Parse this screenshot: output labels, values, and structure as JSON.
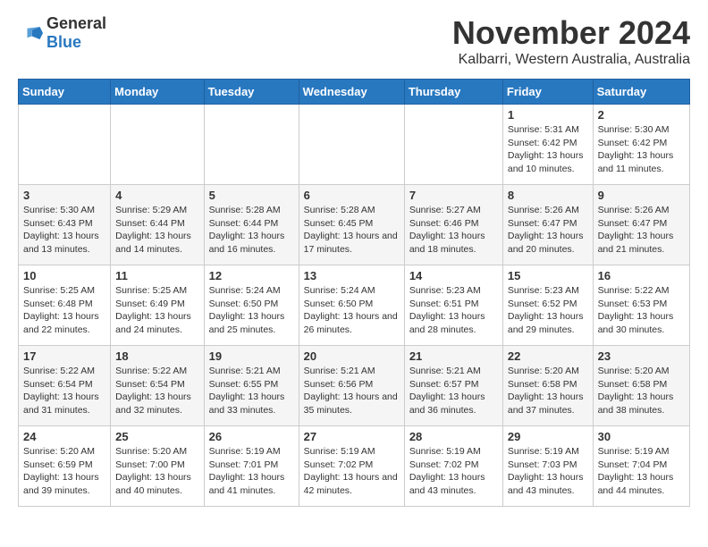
{
  "logo": {
    "text_general": "General",
    "text_blue": "Blue"
  },
  "title": "November 2024",
  "subtitle": "Kalbarri, Western Australia, Australia",
  "days_of_week": [
    "Sunday",
    "Monday",
    "Tuesday",
    "Wednesday",
    "Thursday",
    "Friday",
    "Saturday"
  ],
  "weeks": [
    [
      {
        "day": "",
        "info": ""
      },
      {
        "day": "",
        "info": ""
      },
      {
        "day": "",
        "info": ""
      },
      {
        "day": "",
        "info": ""
      },
      {
        "day": "",
        "info": ""
      },
      {
        "day": "1",
        "info": "Sunrise: 5:31 AM\nSunset: 6:42 PM\nDaylight: 13 hours and 10 minutes."
      },
      {
        "day": "2",
        "info": "Sunrise: 5:30 AM\nSunset: 6:42 PM\nDaylight: 13 hours and 11 minutes."
      }
    ],
    [
      {
        "day": "3",
        "info": "Sunrise: 5:30 AM\nSunset: 6:43 PM\nDaylight: 13 hours and 13 minutes."
      },
      {
        "day": "4",
        "info": "Sunrise: 5:29 AM\nSunset: 6:44 PM\nDaylight: 13 hours and 14 minutes."
      },
      {
        "day": "5",
        "info": "Sunrise: 5:28 AM\nSunset: 6:44 PM\nDaylight: 13 hours and 16 minutes."
      },
      {
        "day": "6",
        "info": "Sunrise: 5:28 AM\nSunset: 6:45 PM\nDaylight: 13 hours and 17 minutes."
      },
      {
        "day": "7",
        "info": "Sunrise: 5:27 AM\nSunset: 6:46 PM\nDaylight: 13 hours and 18 minutes."
      },
      {
        "day": "8",
        "info": "Sunrise: 5:26 AM\nSunset: 6:47 PM\nDaylight: 13 hours and 20 minutes."
      },
      {
        "day": "9",
        "info": "Sunrise: 5:26 AM\nSunset: 6:47 PM\nDaylight: 13 hours and 21 minutes."
      }
    ],
    [
      {
        "day": "10",
        "info": "Sunrise: 5:25 AM\nSunset: 6:48 PM\nDaylight: 13 hours and 22 minutes."
      },
      {
        "day": "11",
        "info": "Sunrise: 5:25 AM\nSunset: 6:49 PM\nDaylight: 13 hours and 24 minutes."
      },
      {
        "day": "12",
        "info": "Sunrise: 5:24 AM\nSunset: 6:50 PM\nDaylight: 13 hours and 25 minutes."
      },
      {
        "day": "13",
        "info": "Sunrise: 5:24 AM\nSunset: 6:50 PM\nDaylight: 13 hours and 26 minutes."
      },
      {
        "day": "14",
        "info": "Sunrise: 5:23 AM\nSunset: 6:51 PM\nDaylight: 13 hours and 28 minutes."
      },
      {
        "day": "15",
        "info": "Sunrise: 5:23 AM\nSunset: 6:52 PM\nDaylight: 13 hours and 29 minutes."
      },
      {
        "day": "16",
        "info": "Sunrise: 5:22 AM\nSunset: 6:53 PM\nDaylight: 13 hours and 30 minutes."
      }
    ],
    [
      {
        "day": "17",
        "info": "Sunrise: 5:22 AM\nSunset: 6:54 PM\nDaylight: 13 hours and 31 minutes."
      },
      {
        "day": "18",
        "info": "Sunrise: 5:22 AM\nSunset: 6:54 PM\nDaylight: 13 hours and 32 minutes."
      },
      {
        "day": "19",
        "info": "Sunrise: 5:21 AM\nSunset: 6:55 PM\nDaylight: 13 hours and 33 minutes."
      },
      {
        "day": "20",
        "info": "Sunrise: 5:21 AM\nSunset: 6:56 PM\nDaylight: 13 hours and 35 minutes."
      },
      {
        "day": "21",
        "info": "Sunrise: 5:21 AM\nSunset: 6:57 PM\nDaylight: 13 hours and 36 minutes."
      },
      {
        "day": "22",
        "info": "Sunrise: 5:20 AM\nSunset: 6:58 PM\nDaylight: 13 hours and 37 minutes."
      },
      {
        "day": "23",
        "info": "Sunrise: 5:20 AM\nSunset: 6:58 PM\nDaylight: 13 hours and 38 minutes."
      }
    ],
    [
      {
        "day": "24",
        "info": "Sunrise: 5:20 AM\nSunset: 6:59 PM\nDaylight: 13 hours and 39 minutes."
      },
      {
        "day": "25",
        "info": "Sunrise: 5:20 AM\nSunset: 7:00 PM\nDaylight: 13 hours and 40 minutes."
      },
      {
        "day": "26",
        "info": "Sunrise: 5:19 AM\nSunset: 7:01 PM\nDaylight: 13 hours and 41 minutes."
      },
      {
        "day": "27",
        "info": "Sunrise: 5:19 AM\nSunset: 7:02 PM\nDaylight: 13 hours and 42 minutes."
      },
      {
        "day": "28",
        "info": "Sunrise: 5:19 AM\nSunset: 7:02 PM\nDaylight: 13 hours and 43 minutes."
      },
      {
        "day": "29",
        "info": "Sunrise: 5:19 AM\nSunset: 7:03 PM\nDaylight: 13 hours and 43 minutes."
      },
      {
        "day": "30",
        "info": "Sunrise: 5:19 AM\nSunset: 7:04 PM\nDaylight: 13 hours and 44 minutes."
      }
    ]
  ]
}
